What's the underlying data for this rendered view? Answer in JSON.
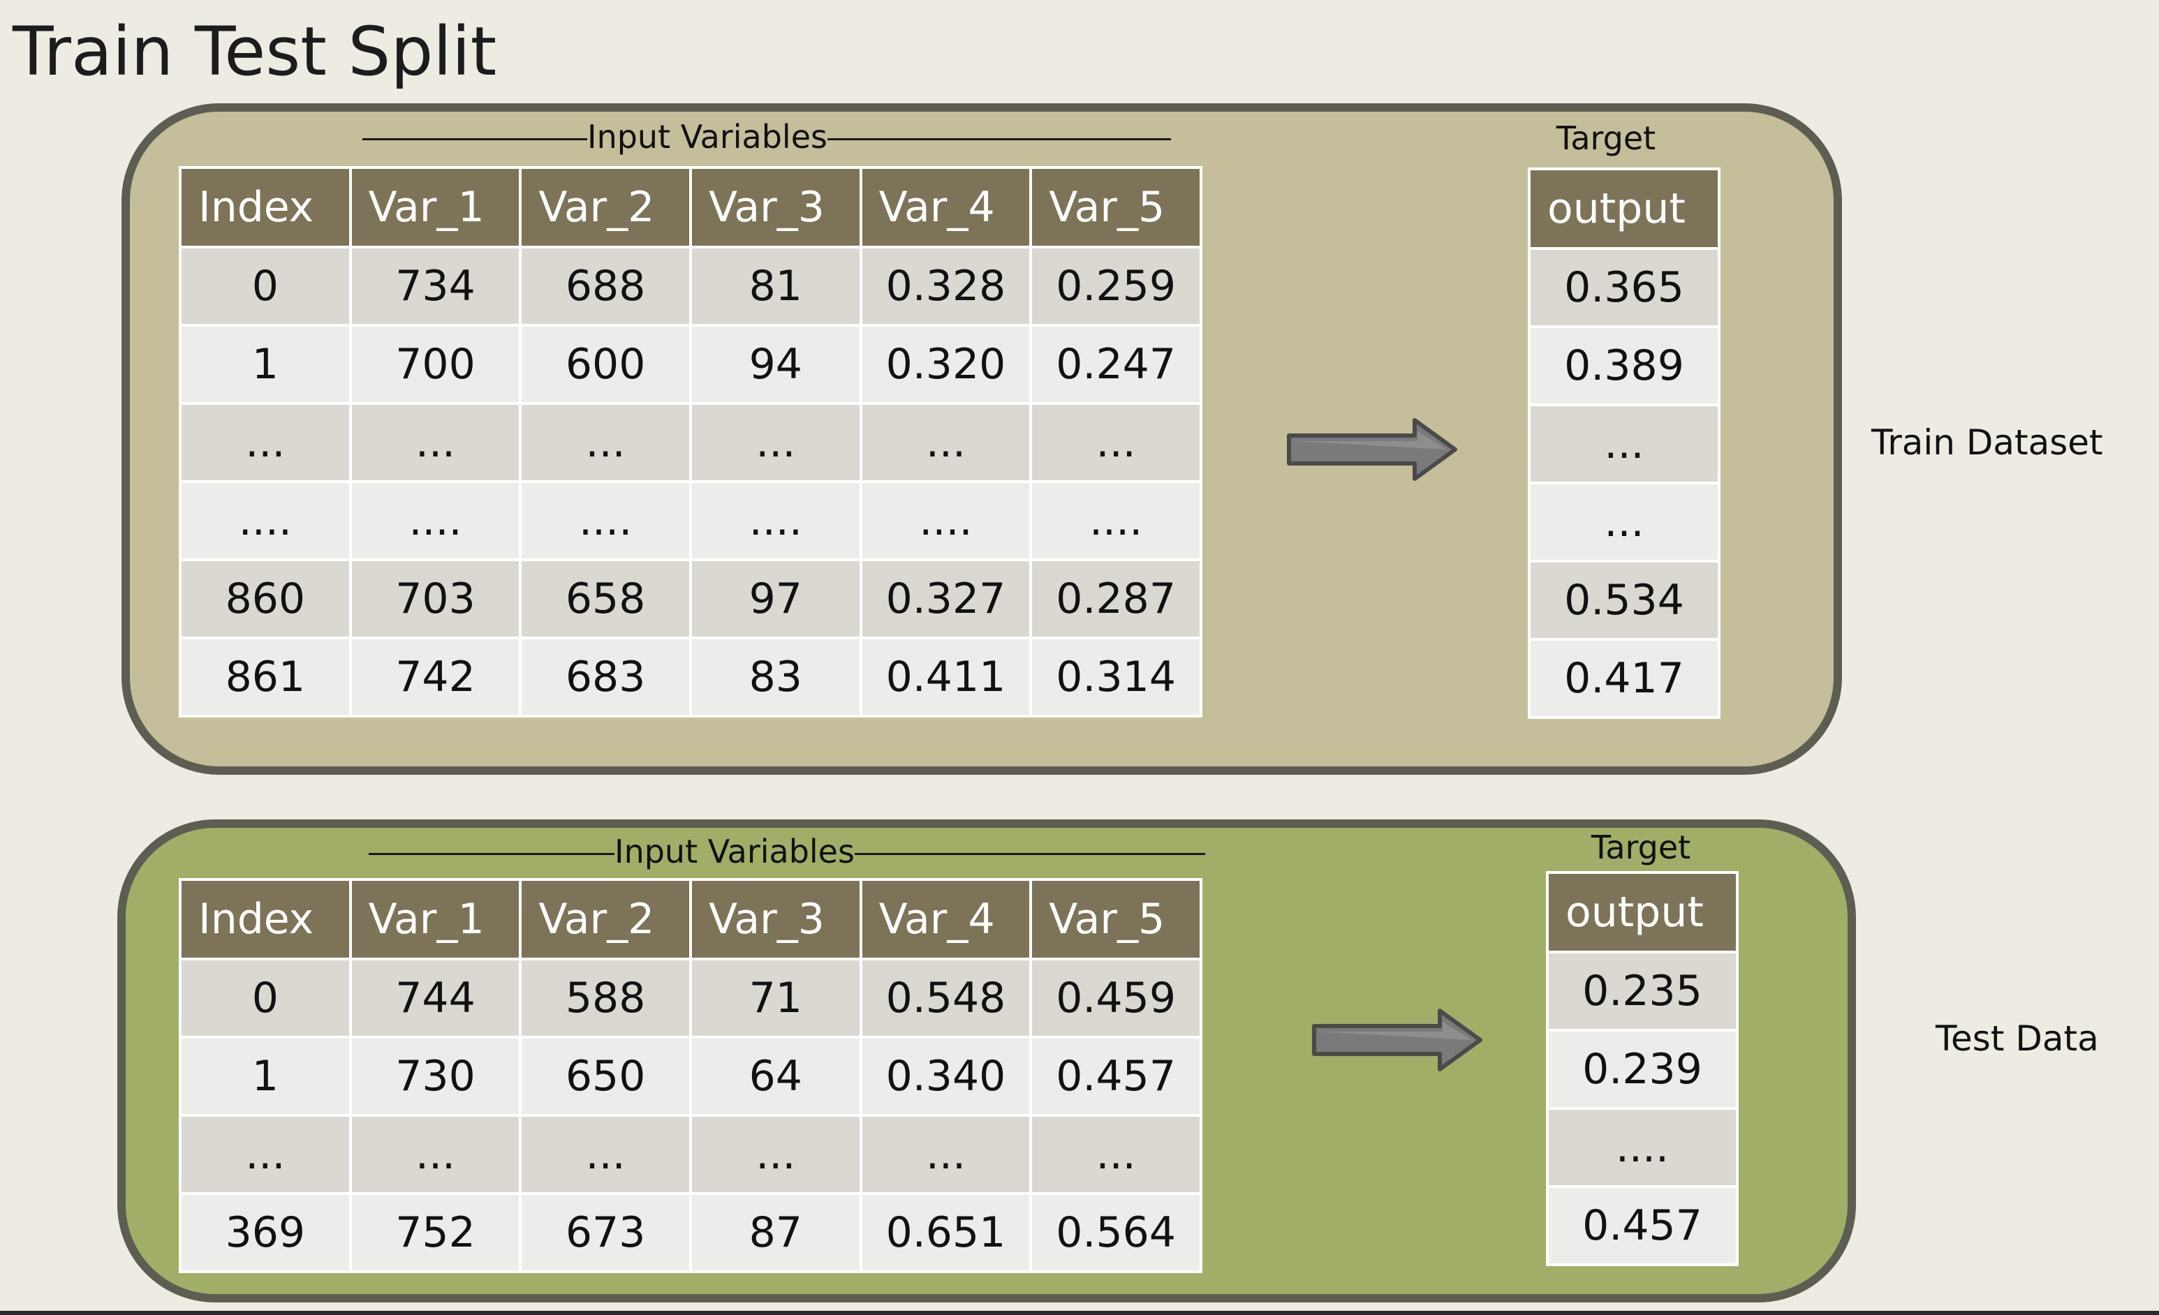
{
  "title": "Train Test Split",
  "colors": {
    "background": "#eeebe3",
    "train_panel": "#c5be9a",
    "test_panel": "#a1ae67",
    "panel_border": "#5d5d52",
    "header": "#7d7358",
    "row_odd": "#dad8d1",
    "row_even": "#ececea",
    "arrow": "#7a7a7a"
  },
  "train": {
    "group_label": "Input Variables",
    "target_label": "Target",
    "side_label": "Train Dataset",
    "columns": [
      "Index",
      "Var_1",
      "Var_2",
      "Var_3",
      "Var_4",
      "Var_5"
    ],
    "rows": [
      [
        "0",
        "734",
        "688",
        "81",
        "0.328",
        "0.259"
      ],
      [
        "1",
        "700",
        "600",
        "94",
        "0.320",
        "0.247"
      ],
      [
        "...",
        "...",
        "...",
        "...",
        "...",
        "..."
      ],
      [
        "....",
        "....",
        "....",
        "....",
        "....",
        "...."
      ],
      [
        "860",
        "703",
        "658",
        "97",
        "0.327",
        "0.287"
      ],
      [
        "861",
        "742",
        "683",
        "83",
        "0.411",
        "0.314"
      ]
    ],
    "output_header": "output",
    "output_rows": [
      "0.365",
      "0.389",
      "...",
      "...",
      "0.534",
      "0.417"
    ],
    "arrow_icon": "right-arrow-icon"
  },
  "test": {
    "group_label": "Input Variables",
    "target_label": "Target",
    "side_label": "Test Data",
    "columns": [
      "Index",
      "Var_1",
      "Var_2",
      "Var_3",
      "Var_4",
      "Var_5"
    ],
    "rows": [
      [
        "0",
        "744",
        "588",
        "71",
        "0.548",
        "0.459"
      ],
      [
        "1",
        "730",
        "650",
        "64",
        "0.340",
        "0.457"
      ],
      [
        "...",
        "...",
        "...",
        "...",
        "...",
        "..."
      ],
      [
        "369",
        "752",
        "673",
        "87",
        "0.651",
        "0.564"
      ]
    ],
    "output_header": "output",
    "output_rows": [
      "0.235",
      "0.239",
      "....",
      "0.457"
    ],
    "arrow_icon": "right-arrow-icon"
  }
}
